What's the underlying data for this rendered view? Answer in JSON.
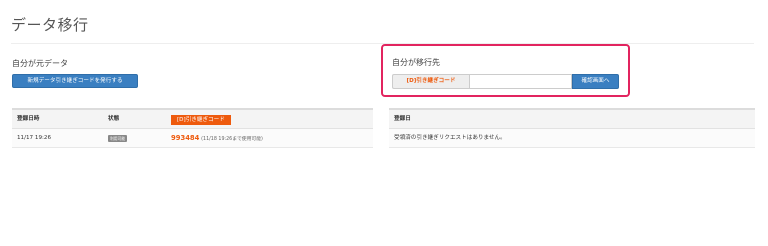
{
  "page": {
    "title": "データ移行"
  },
  "source_panel": {
    "label": "自分が元データ",
    "issue_button": "新規データ引き継ぎコードを発行する"
  },
  "target_panel": {
    "label": "自分が移行先",
    "code_addon": "[D]引き継ぎコード",
    "code_value": "",
    "code_placeholder": "",
    "confirm_button": "確認画面へ"
  },
  "issued_table": {
    "headers": {
      "date": "登録日時",
      "status": "状態",
      "code": "[D]引き継ぎコード"
    },
    "rows": [
      {
        "date": "11/17 19:26",
        "status": "利用可能",
        "code": "993484",
        "note": "(11/18 19:26まで使用可能)"
      }
    ]
  },
  "received_table": {
    "headers": {
      "date": "登録日"
    },
    "empty_message": "受領済の引き継ぎリクエストはありません。"
  },
  "colors": {
    "accent": "#ee5a0d",
    "primary": "#3a7fc1",
    "highlight": "#e2245f"
  }
}
